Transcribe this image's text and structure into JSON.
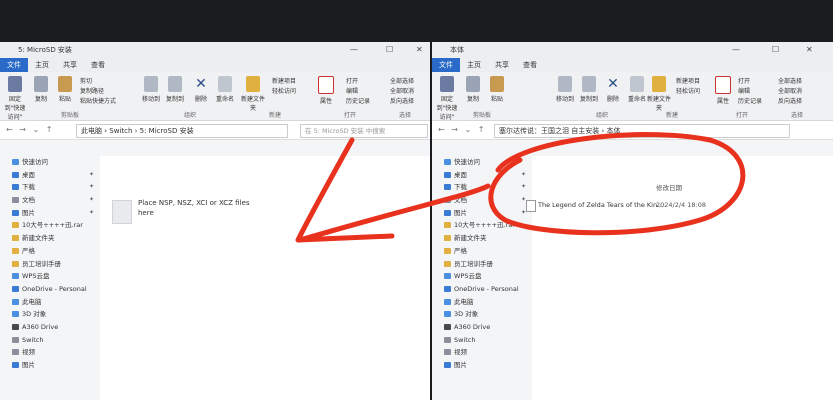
{
  "left_window": {
    "title": "5: MicroSD 安装",
    "tabs": [
      "文件",
      "主页",
      "共享",
      "查看"
    ],
    "ribbon": {
      "pin_label": "固定到\"快速访问\"",
      "copy_label": "复制",
      "paste_label": "粘贴",
      "cut_label": "剪切",
      "copy_path_label": "复制路径",
      "paste_shortcut_label": "粘贴快捷方式",
      "move_to_label": "移动到",
      "copy_to_label": "复制到",
      "delete_label": "删除",
      "rename_label": "重命名",
      "new_folder_label": "新建文件夹",
      "new_item_label": "新建项目",
      "easy_access_label": "轻松访问",
      "properties_label": "属性",
      "open_label": "打开",
      "edit_label": "编辑",
      "history_label": "历史记录",
      "select_all_label": "全部选择",
      "select_none_label": "全部取消",
      "invert_label": "反向选择",
      "group_clipboard": "剪贴板",
      "group_organize": "组织",
      "group_new": "新建",
      "group_open": "打开",
      "group_select": "选择"
    },
    "breadcrumb": "此电脑 › Switch › 5: MicroSD 安装",
    "search_placeholder": "在 5: MicroSD 安装 中搜索",
    "sidebar": [
      {
        "label": "快速访问",
        "color": "#4a8fe0"
      },
      {
        "label": "桌面",
        "color": "#3a7bd5"
      },
      {
        "label": "下载",
        "color": "#3a7bd5"
      },
      {
        "label": "文档",
        "color": "#8a8f99"
      },
      {
        "label": "图片",
        "color": "#3a7bd5"
      },
      {
        "label": "10大号++++迅.rar",
        "color": "#e0b040"
      },
      {
        "label": "新建文件夹",
        "color": "#e0b040"
      },
      {
        "label": "严格",
        "color": "#e0b040"
      },
      {
        "label": "员工培训手册",
        "color": "#e0b040"
      },
      {
        "label": "WPS云盘",
        "color": "#4a8fe0"
      },
      {
        "label": "OneDrive - Personal",
        "color": "#3a7bd5"
      },
      {
        "label": "此电脑",
        "color": "#4a8fe0"
      },
      {
        "label": "3D 对象",
        "color": "#4a8fe0"
      },
      {
        "label": "A360 Drive",
        "color": "#4a4a4a"
      },
      {
        "label": "Switch",
        "color": "#8a8f99"
      },
      {
        "label": "视频",
        "color": "#8a8f99"
      },
      {
        "label": "图片",
        "color": "#3a7bd5"
      }
    ],
    "file": "Place NSP, NSZ, XCI or XCZ files here"
  },
  "right_window": {
    "title": "本体",
    "tabs": [
      "文件",
      "主页",
      "共享",
      "查看"
    ],
    "ribbon": {
      "pin_label": "固定到\"快速访问\"",
      "copy_label": "复制",
      "paste_label": "粘贴",
      "move_to_label": "移动到",
      "copy_to_label": "复制到",
      "delete_label": "删除",
      "rename_label": "重命名",
      "new_folder_label": "新建文件夹",
      "new_item_label": "新建项目",
      "easy_access_label": "轻松访问",
      "properties_label": "属性",
      "open_label": "打开",
      "edit_label": "编辑",
      "history_label": "历史记录",
      "select_all_label": "全部选择",
      "select_none_label": "全部取消",
      "invert_label": "反向选择",
      "group_clipboard": "剪贴板",
      "group_organize": "组织",
      "group_new": "新建",
      "group_open": "打开",
      "group_select": "选择"
    },
    "breadcrumb": "塞尔达传说：王国之泪 自主安装 › 本体",
    "column_date": "修改日期",
    "file_name": "The Legend of Zelda Tears of the Kin...",
    "file_date": "2024/2/4 18:08",
    "sidebar": [
      {
        "label": "快速访问",
        "color": "#4a8fe0"
      },
      {
        "label": "桌面",
        "color": "#3a7bd5"
      },
      {
        "label": "下载",
        "color": "#3a7bd5"
      },
      {
        "label": "文档",
        "color": "#8a8f99"
      },
      {
        "label": "图片",
        "color": "#3a7bd5"
      },
      {
        "label": "10大号++++迅.rar",
        "color": "#e0b040"
      },
      {
        "label": "新建文件夹",
        "color": "#e0b040"
      },
      {
        "label": "严格",
        "color": "#e0b040"
      },
      {
        "label": "员工培训手册",
        "color": "#e0b040"
      },
      {
        "label": "WPS云盘",
        "color": "#4a8fe0"
      },
      {
        "label": "OneDrive - Personal",
        "color": "#3a7bd5"
      },
      {
        "label": "此电脑",
        "color": "#4a8fe0"
      },
      {
        "label": "3D 对象",
        "color": "#4a8fe0"
      },
      {
        "label": "A360 Drive",
        "color": "#4a4a4a"
      },
      {
        "label": "Switch",
        "color": "#8a8f99"
      },
      {
        "label": "视频",
        "color": "#8a8f99"
      },
      {
        "label": "图片",
        "color": "#3a7bd5"
      }
    ]
  },
  "colors": {
    "annotation": "#e8321e",
    "accent": "#2a6bc9",
    "folder": "#e0b040"
  }
}
